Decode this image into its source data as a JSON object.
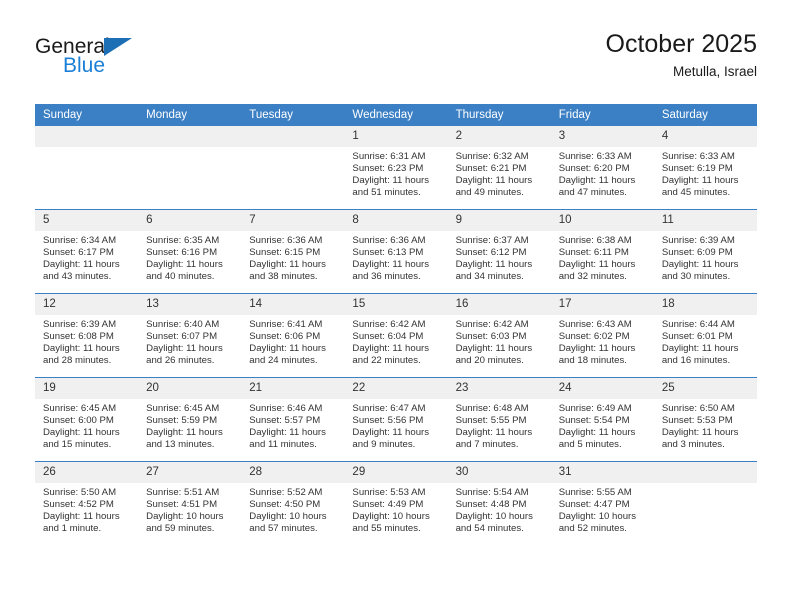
{
  "brand": {
    "name_dark": "General",
    "name_blue": "Blue",
    "triangle_color": "#1c6fb5",
    "blue_color": "#1c7fd6"
  },
  "header": {
    "title": "October 2025",
    "subtitle": "Metulla, Israel"
  },
  "theme": {
    "header_bg": "#3b7fc4",
    "daynum_bg": "#f0f0f0",
    "text": "#333333"
  },
  "weekday_headers": [
    "Sunday",
    "Monday",
    "Tuesday",
    "Wednesday",
    "Thursday",
    "Friday",
    "Saturday"
  ],
  "weeks": [
    [
      {
        "day": "",
        "sunrise": "",
        "sunset": "",
        "daylight": "",
        "empty": true
      },
      {
        "day": "",
        "sunrise": "",
        "sunset": "",
        "daylight": "",
        "empty": true
      },
      {
        "day": "",
        "sunrise": "",
        "sunset": "",
        "daylight": "",
        "empty": true
      },
      {
        "day": "1",
        "sunrise": "Sunrise: 6:31 AM",
        "sunset": "Sunset: 6:23 PM",
        "daylight": "Daylight: 11 hours and 51 minutes.",
        "empty": false
      },
      {
        "day": "2",
        "sunrise": "Sunrise: 6:32 AM",
        "sunset": "Sunset: 6:21 PM",
        "daylight": "Daylight: 11 hours and 49 minutes.",
        "empty": false
      },
      {
        "day": "3",
        "sunrise": "Sunrise: 6:33 AM",
        "sunset": "Sunset: 6:20 PM",
        "daylight": "Daylight: 11 hours and 47 minutes.",
        "empty": false
      },
      {
        "day": "4",
        "sunrise": "Sunrise: 6:33 AM",
        "sunset": "Sunset: 6:19 PM",
        "daylight": "Daylight: 11 hours and 45 minutes.",
        "empty": false
      }
    ],
    [
      {
        "day": "5",
        "sunrise": "Sunrise: 6:34 AM",
        "sunset": "Sunset: 6:17 PM",
        "daylight": "Daylight: 11 hours and 43 minutes.",
        "empty": false
      },
      {
        "day": "6",
        "sunrise": "Sunrise: 6:35 AM",
        "sunset": "Sunset: 6:16 PM",
        "daylight": "Daylight: 11 hours and 40 minutes.",
        "empty": false
      },
      {
        "day": "7",
        "sunrise": "Sunrise: 6:36 AM",
        "sunset": "Sunset: 6:15 PM",
        "daylight": "Daylight: 11 hours and 38 minutes.",
        "empty": false
      },
      {
        "day": "8",
        "sunrise": "Sunrise: 6:36 AM",
        "sunset": "Sunset: 6:13 PM",
        "daylight": "Daylight: 11 hours and 36 minutes.",
        "empty": false
      },
      {
        "day": "9",
        "sunrise": "Sunrise: 6:37 AM",
        "sunset": "Sunset: 6:12 PM",
        "daylight": "Daylight: 11 hours and 34 minutes.",
        "empty": false
      },
      {
        "day": "10",
        "sunrise": "Sunrise: 6:38 AM",
        "sunset": "Sunset: 6:11 PM",
        "daylight": "Daylight: 11 hours and 32 minutes.",
        "empty": false
      },
      {
        "day": "11",
        "sunrise": "Sunrise: 6:39 AM",
        "sunset": "Sunset: 6:09 PM",
        "daylight": "Daylight: 11 hours and 30 minutes.",
        "empty": false
      }
    ],
    [
      {
        "day": "12",
        "sunrise": "Sunrise: 6:39 AM",
        "sunset": "Sunset: 6:08 PM",
        "daylight": "Daylight: 11 hours and 28 minutes.",
        "empty": false
      },
      {
        "day": "13",
        "sunrise": "Sunrise: 6:40 AM",
        "sunset": "Sunset: 6:07 PM",
        "daylight": "Daylight: 11 hours and 26 minutes.",
        "empty": false
      },
      {
        "day": "14",
        "sunrise": "Sunrise: 6:41 AM",
        "sunset": "Sunset: 6:06 PM",
        "daylight": "Daylight: 11 hours and 24 minutes.",
        "empty": false
      },
      {
        "day": "15",
        "sunrise": "Sunrise: 6:42 AM",
        "sunset": "Sunset: 6:04 PM",
        "daylight": "Daylight: 11 hours and 22 minutes.",
        "empty": false
      },
      {
        "day": "16",
        "sunrise": "Sunrise: 6:42 AM",
        "sunset": "Sunset: 6:03 PM",
        "daylight": "Daylight: 11 hours and 20 minutes.",
        "empty": false
      },
      {
        "day": "17",
        "sunrise": "Sunrise: 6:43 AM",
        "sunset": "Sunset: 6:02 PM",
        "daylight": "Daylight: 11 hours and 18 minutes.",
        "empty": false
      },
      {
        "day": "18",
        "sunrise": "Sunrise: 6:44 AM",
        "sunset": "Sunset: 6:01 PM",
        "daylight": "Daylight: 11 hours and 16 minutes.",
        "empty": false
      }
    ],
    [
      {
        "day": "19",
        "sunrise": "Sunrise: 6:45 AM",
        "sunset": "Sunset: 6:00 PM",
        "daylight": "Daylight: 11 hours and 15 minutes.",
        "empty": false
      },
      {
        "day": "20",
        "sunrise": "Sunrise: 6:45 AM",
        "sunset": "Sunset: 5:59 PM",
        "daylight": "Daylight: 11 hours and 13 minutes.",
        "empty": false
      },
      {
        "day": "21",
        "sunrise": "Sunrise: 6:46 AM",
        "sunset": "Sunset: 5:57 PM",
        "daylight": "Daylight: 11 hours and 11 minutes.",
        "empty": false
      },
      {
        "day": "22",
        "sunrise": "Sunrise: 6:47 AM",
        "sunset": "Sunset: 5:56 PM",
        "daylight": "Daylight: 11 hours and 9 minutes.",
        "empty": false
      },
      {
        "day": "23",
        "sunrise": "Sunrise: 6:48 AM",
        "sunset": "Sunset: 5:55 PM",
        "daylight": "Daylight: 11 hours and 7 minutes.",
        "empty": false
      },
      {
        "day": "24",
        "sunrise": "Sunrise: 6:49 AM",
        "sunset": "Sunset: 5:54 PM",
        "daylight": "Daylight: 11 hours and 5 minutes.",
        "empty": false
      },
      {
        "day": "25",
        "sunrise": "Sunrise: 6:50 AM",
        "sunset": "Sunset: 5:53 PM",
        "daylight": "Daylight: 11 hours and 3 minutes.",
        "empty": false
      }
    ],
    [
      {
        "day": "26",
        "sunrise": "Sunrise: 5:50 AM",
        "sunset": "Sunset: 4:52 PM",
        "daylight": "Daylight: 11 hours and 1 minute.",
        "empty": false
      },
      {
        "day": "27",
        "sunrise": "Sunrise: 5:51 AM",
        "sunset": "Sunset: 4:51 PM",
        "daylight": "Daylight: 10 hours and 59 minutes.",
        "empty": false
      },
      {
        "day": "28",
        "sunrise": "Sunrise: 5:52 AM",
        "sunset": "Sunset: 4:50 PM",
        "daylight": "Daylight: 10 hours and 57 minutes.",
        "empty": false
      },
      {
        "day": "29",
        "sunrise": "Sunrise: 5:53 AM",
        "sunset": "Sunset: 4:49 PM",
        "daylight": "Daylight: 10 hours and 55 minutes.",
        "empty": false
      },
      {
        "day": "30",
        "sunrise": "Sunrise: 5:54 AM",
        "sunset": "Sunset: 4:48 PM",
        "daylight": "Daylight: 10 hours and 54 minutes.",
        "empty": false
      },
      {
        "day": "31",
        "sunrise": "Sunrise: 5:55 AM",
        "sunset": "Sunset: 4:47 PM",
        "daylight": "Daylight: 10 hours and 52 minutes.",
        "empty": false
      },
      {
        "day": "",
        "sunrise": "",
        "sunset": "",
        "daylight": "",
        "empty": true
      }
    ]
  ]
}
